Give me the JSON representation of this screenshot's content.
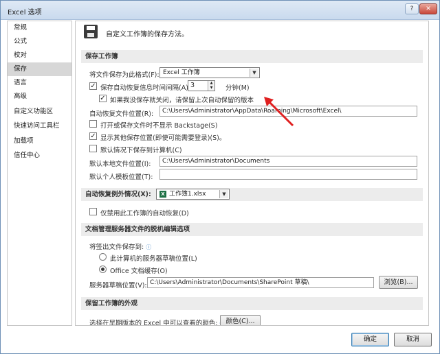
{
  "window": {
    "title": "Excel 选项",
    "help_label": "?",
    "close_label": "✕"
  },
  "nav": {
    "items": [
      {
        "label": "常规"
      },
      {
        "label": "公式"
      },
      {
        "label": "校对"
      },
      {
        "label": "保存",
        "selected": true
      },
      {
        "label": "语言"
      },
      {
        "label": "高级"
      },
      {
        "label": "自定义功能区"
      },
      {
        "label": "快速访问工具栏"
      },
      {
        "label": "加载项"
      },
      {
        "label": "信任中心"
      }
    ]
  },
  "header": {
    "text": "自定义工作簿的保存方法。",
    "icon": "floppy-disk-icon"
  },
  "save_section": {
    "title": "保存工作簿",
    "format_label": "将文件保存为此格式(F):",
    "format_value": "Excel 工作簿",
    "autorecover_label": "保存自动恢复信息时间间隔(A)",
    "autorecover_checked": true,
    "autorecover_value": "3",
    "minutes_label": "分钟(M)",
    "keep_last_label": "如果我没保存就关闭，请保留上次自动保留的版本",
    "keep_last_checked": true,
    "autorecover_location_label": "自动恢复文件位置(R):",
    "autorecover_location_value": "C:\\Users\\Administrator\\AppData\\Roaming\\Microsoft\\Excel\\",
    "no_backstage_label": "打开或保存文件时不显示 Backstage(S)",
    "no_backstage_checked": false,
    "show_more_label": "显示其他保存位置(即使可能需要登录)(S)。",
    "show_more_checked": true,
    "default_computer_label": "默认情况下保存到计算机(C)",
    "default_computer_checked": false,
    "default_local_label": "默认本地文件位置(I):",
    "default_local_value": "C:\\Users\\Administrator\\Documents",
    "template_label": "默认个人模板位置(T):",
    "template_value": ""
  },
  "autorecover_exceptions": {
    "label": "自动恢复例外情况(X):",
    "workbook_value": "工作簿1.xlsx",
    "disable_label": "仅禁用此工作簿的自动恢复(D)",
    "disable_checked": false
  },
  "offline_section": {
    "title": "文档管理服务器文件的脱机编辑选项",
    "checkout_label": "将签出文件保存到:",
    "option_server": "此计算机的服务器草稿位置(L)",
    "option_cache": "Office 文档缓存(O)",
    "selected": "cache",
    "drafts_label": "服务器草稿位置(V):",
    "drafts_value": "C:\\Users\\Administrator\\Documents\\SharePoint 草稿\\",
    "browse_label": "浏览(B)..."
  },
  "appearance_section": {
    "title": "保留工作簿的外观",
    "colors_label": "选择在早期版本的 Excel 中可以查看的颜色:",
    "colors_button": "颜色(C)..."
  },
  "footer": {
    "ok_label": "确定",
    "cancel_label": "取消"
  },
  "annotation": {
    "arrow_color": "#e02020"
  }
}
